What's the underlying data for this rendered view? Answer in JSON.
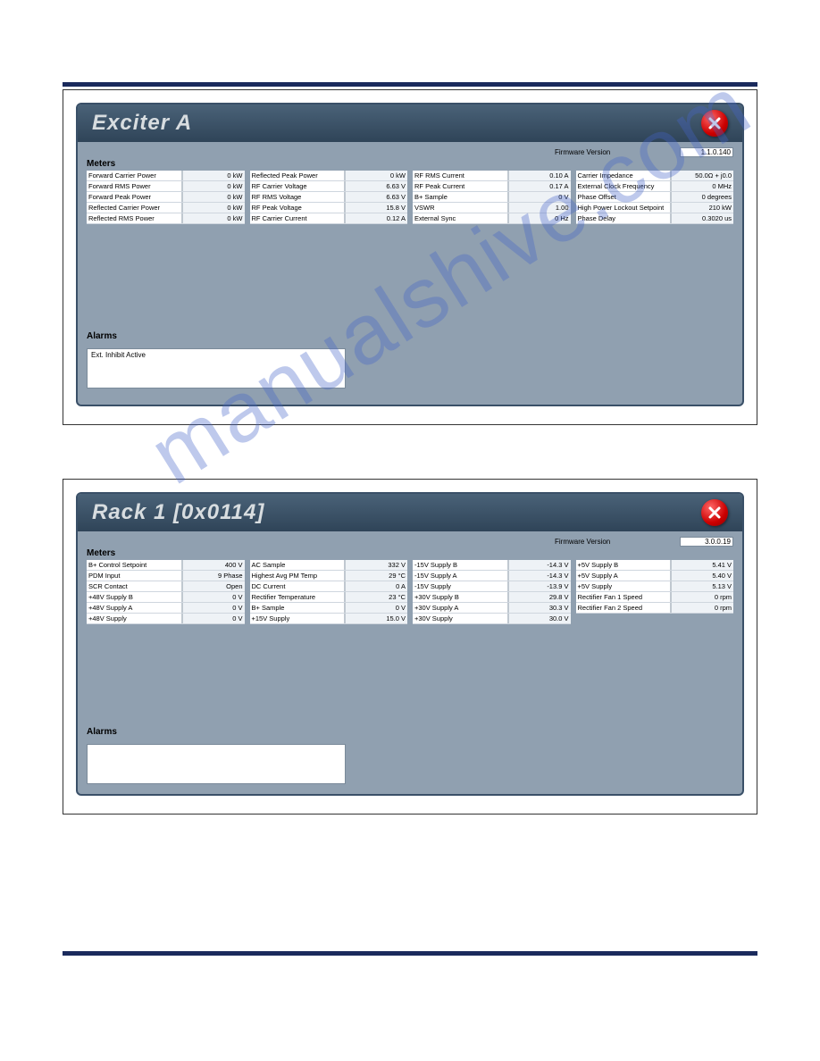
{
  "watermark": "manualshive.com",
  "panels": [
    {
      "title": "Exciter A",
      "firmware_label": "Firmware Version",
      "firmware_value": "1.1.0.140",
      "meters_label": "Meters",
      "alarms_label": "Alarms",
      "alarm_text": "Ext. Inhibit Active",
      "columns": [
        [
          {
            "lbl": "Forward Carrier Power",
            "val": "0 kW"
          },
          {
            "lbl": "Forward RMS Power",
            "val": "0 kW"
          },
          {
            "lbl": "Forward Peak Power",
            "val": "0 kW"
          },
          {
            "lbl": "Reflected Carrier Power",
            "val": "0 kW"
          },
          {
            "lbl": "Reflected RMS Power",
            "val": "0 kW"
          }
        ],
        [
          {
            "lbl": "Reflected Peak Power",
            "val": "0 kW"
          },
          {
            "lbl": "RF Carrier Voltage",
            "val": "6.63 V"
          },
          {
            "lbl": "RF RMS Voltage",
            "val": "6.63 V"
          },
          {
            "lbl": "RF Peak Voltage",
            "val": "15.8 V"
          },
          {
            "lbl": "RF Carrier Current",
            "val": "0.12 A"
          }
        ],
        [
          {
            "lbl": "RF RMS Current",
            "val": "0.10 A"
          },
          {
            "lbl": "RF Peak Current",
            "val": "0.17 A"
          },
          {
            "lbl": "B+ Sample",
            "val": "0 V"
          },
          {
            "lbl": "VSWR",
            "val": "1.00"
          },
          {
            "lbl": "External Sync",
            "val": "0 Hz"
          }
        ],
        [
          {
            "lbl": "Carrier Impedance",
            "val": "50.0Ω + j0.0"
          },
          {
            "lbl": "External Clock Frequency",
            "val": "0 MHz"
          },
          {
            "lbl": "Phase Offset",
            "val": "0 degrees"
          },
          {
            "lbl": "High Power Lockout Setpoint",
            "val": "210 kW"
          },
          {
            "lbl": "Phase Delay",
            "val": "0.3020 us"
          }
        ]
      ]
    },
    {
      "title": "Rack 1 [0x0114]",
      "firmware_label": "Firmware Version",
      "firmware_value": "3.0.0.19",
      "meters_label": "Meters",
      "alarms_label": "Alarms",
      "alarm_text": "",
      "columns": [
        [
          {
            "lbl": "B+ Control Setpoint",
            "val": "400 V"
          },
          {
            "lbl": "PDM Input",
            "val": "9 Phase"
          },
          {
            "lbl": "SCR Contact",
            "val": "Open"
          },
          {
            "lbl": "+48V Supply B",
            "val": "0 V"
          },
          {
            "lbl": "+48V Supply A",
            "val": "0 V"
          },
          {
            "lbl": "+48V Supply",
            "val": "0 V"
          }
        ],
        [
          {
            "lbl": "AC Sample",
            "val": "332 V"
          },
          {
            "lbl": "Highest Avg PM Temp",
            "val": "29 °C"
          },
          {
            "lbl": "DC Current",
            "val": "0 A"
          },
          {
            "lbl": "Rectifier Temperature",
            "val": "23 °C"
          },
          {
            "lbl": "B+ Sample",
            "val": "0 V"
          },
          {
            "lbl": "+15V Supply",
            "val": "15.0 V"
          }
        ],
        [
          {
            "lbl": "-15V Supply B",
            "val": "-14.3 V"
          },
          {
            "lbl": "-15V Supply A",
            "val": "-14.3 V"
          },
          {
            "lbl": "-15V Supply",
            "val": "-13.9 V"
          },
          {
            "lbl": "+30V Supply B",
            "val": "29.8 V"
          },
          {
            "lbl": "+30V Supply A",
            "val": "30.3 V"
          },
          {
            "lbl": "+30V Supply",
            "val": "30.0 V"
          }
        ],
        [
          {
            "lbl": "+5V Supply B",
            "val": "5.41 V"
          },
          {
            "lbl": "+5V Supply A",
            "val": "5.40 V"
          },
          {
            "lbl": "+5V Supply",
            "val": "5.13 V"
          },
          {
            "lbl": "Rectifier Fan 1 Speed",
            "val": "0 rpm"
          },
          {
            "lbl": "Rectifier Fan 2 Speed",
            "val": "0 rpm"
          }
        ]
      ]
    }
  ]
}
